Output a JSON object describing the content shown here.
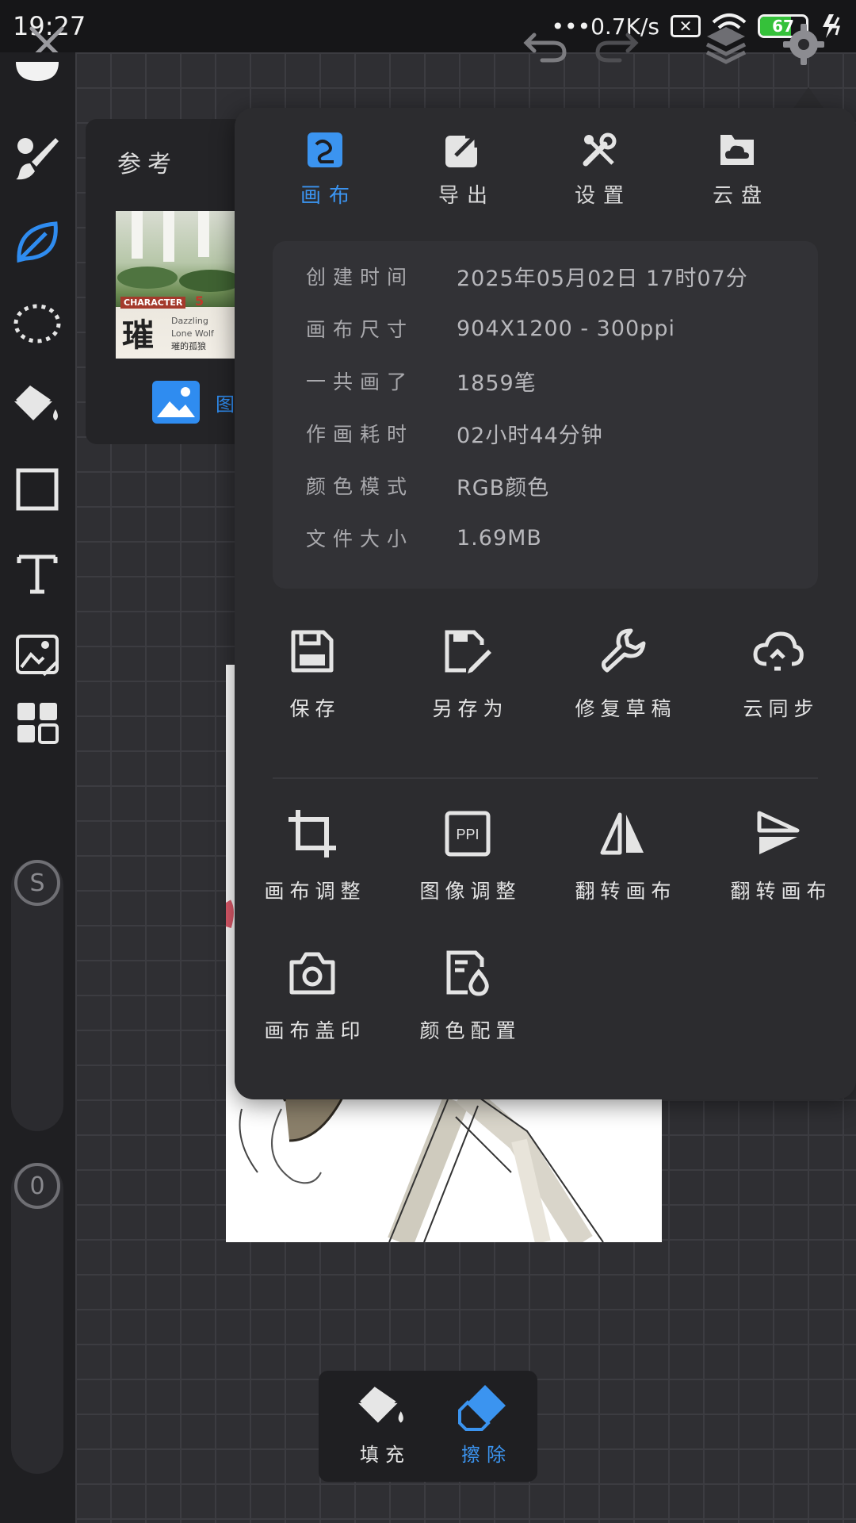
{
  "status_bar": {
    "time": "19:27",
    "net_speed": "0.7K/s",
    "battery": "67",
    "battery_level": 0.67,
    "colors": {
      "battery_fill": "#35c13a"
    }
  },
  "toolbar": {
    "icons": [
      "close-icon",
      "undo-icon",
      "redo-icon",
      "layers-icon",
      "settings-icon"
    ]
  },
  "left_rail": {
    "tools": [
      "brush-icon",
      "leaf-smudge-icon",
      "lasso-icon",
      "fill-bucket-icon",
      "rectangle-icon",
      "text-icon",
      "image-transform-icon",
      "grid-icon"
    ],
    "size_slider_label": "S",
    "opacity_slider_label": "0"
  },
  "reference": {
    "title": "参考",
    "image_button": "图",
    "thumb_tag": "CHARACTER",
    "thumb_char": "璀",
    "thumb_sub1": "Dazzling",
    "thumb_sub2": "Lone Wolf",
    "thumb_sub3": "璀的孤狼",
    "thumb_num": "5"
  },
  "menu": {
    "tabs": [
      {
        "label": "画布",
        "icon": "canvas-icon",
        "active": true
      },
      {
        "label": "导出",
        "icon": "export-icon",
        "active": false
      },
      {
        "label": "设置",
        "icon": "tools-icon",
        "active": false
      },
      {
        "label": "云盘",
        "icon": "cloud-drive-icon",
        "active": false
      }
    ],
    "info": [
      {
        "label": "创建时间",
        "value": "2025年05月02日 17时07分"
      },
      {
        "label": "画布尺寸",
        "value": "904X1200 - 300ppi"
      },
      {
        "label": "一共画了",
        "value": "1859笔"
      },
      {
        "label": "作画耗时",
        "value": "02小时44分钟"
      },
      {
        "label": "颜色模式",
        "value": "RGB颜色"
      },
      {
        "label": "文件大小",
        "value": "1.69MB"
      }
    ],
    "actions_row1": [
      {
        "label": "保存",
        "icon": "save-icon"
      },
      {
        "label": "另存为",
        "icon": "save-as-icon"
      },
      {
        "label": "修复草稿",
        "icon": "repair-icon"
      },
      {
        "label": "云同步",
        "icon": "cloud-sync-icon"
      }
    ],
    "actions_row2": [
      {
        "label": "画布调整",
        "icon": "crop-icon"
      },
      {
        "label": "图像调整",
        "icon": "ppi-icon"
      },
      {
        "label": "翻转画布",
        "icon": "flip-horizontal-icon"
      },
      {
        "label": "翻转画布",
        "icon": "flip-vertical-icon"
      }
    ],
    "actions_row3": [
      {
        "label": "画布盖印",
        "icon": "camera-icon"
      },
      {
        "label": "颜色配置",
        "icon": "color-profile-icon"
      }
    ],
    "ppi_text": "PPI",
    "colors": {
      "accent": "#3b94f0",
      "panel": "#2c2c2f"
    }
  },
  "bottom_popup": {
    "items": [
      {
        "label": "填充",
        "icon": "fill-bucket-icon",
        "active": false
      },
      {
        "label": "擦除",
        "icon": "eraser-icon",
        "active": true
      }
    ]
  }
}
